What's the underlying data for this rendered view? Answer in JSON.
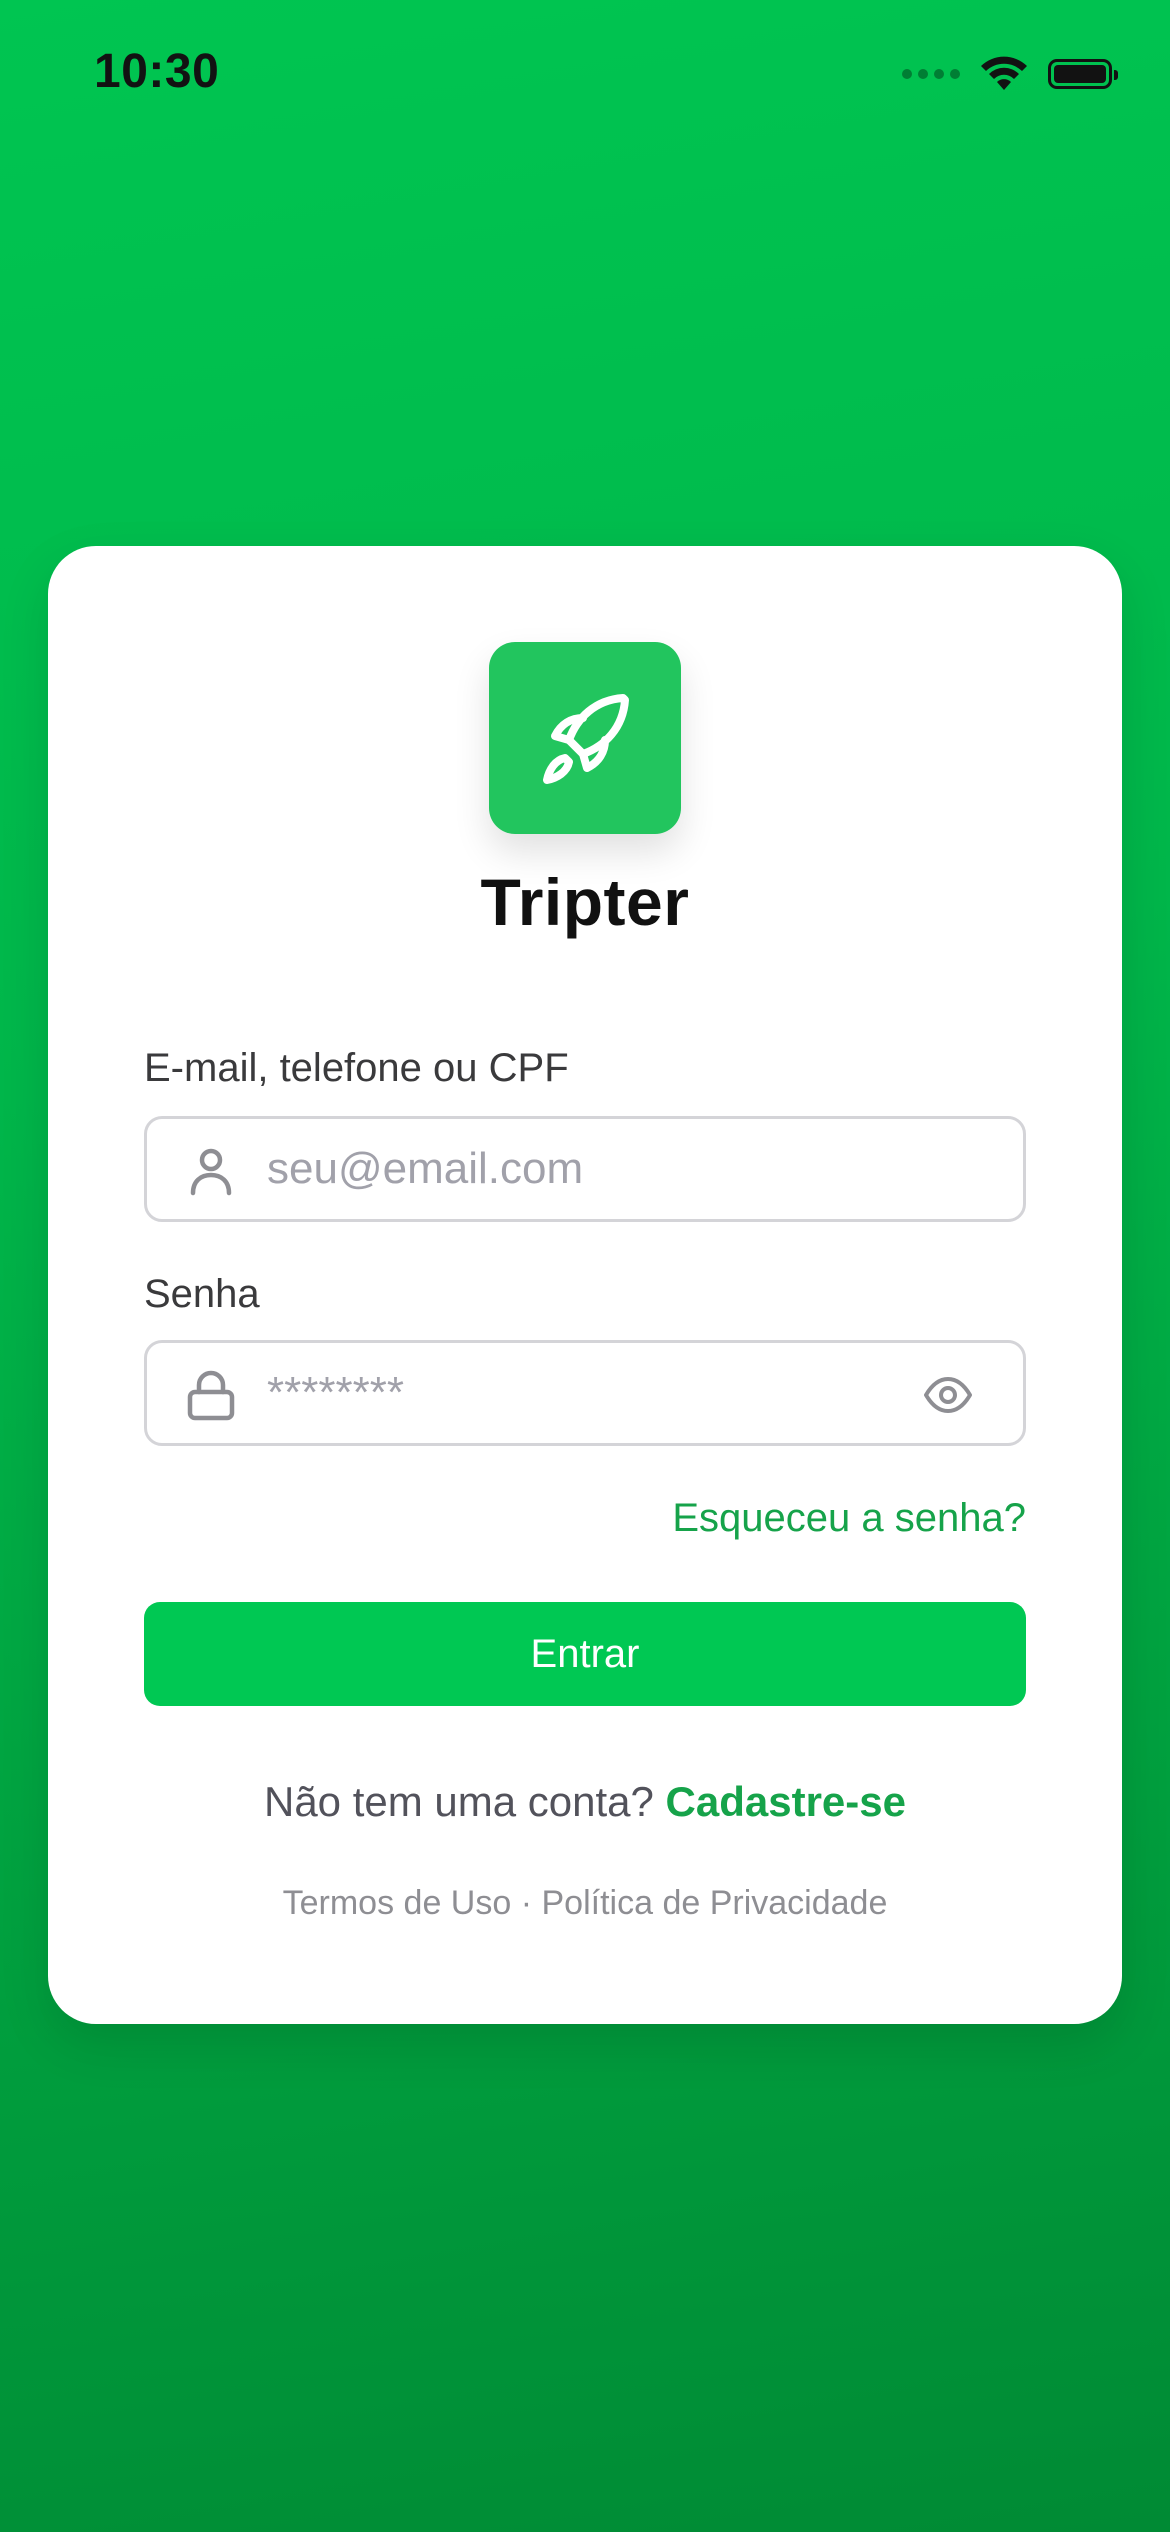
{
  "status_bar": {
    "time": "10:30"
  },
  "app": {
    "name": "Tripter",
    "logo_icon": "rocket-icon",
    "brand_color": "#22c55e"
  },
  "form": {
    "identifier": {
      "label": "E-mail, telefone ou CPF",
      "placeholder": "seu@email.com",
      "value": "",
      "icon": "user-icon"
    },
    "password": {
      "label": "Senha",
      "placeholder": "********",
      "value": "",
      "icon": "lock-icon",
      "toggle_icon": "eye-icon"
    },
    "forgot_label": "Esqueceu a senha?",
    "submit_label": "Entrar"
  },
  "footer": {
    "no_account_text": "Não tem uma conta?",
    "signup_label": "Cadastre-se",
    "terms_label": "Termos de Uso",
    "separator": "·",
    "privacy_label": "Política de Privacidade"
  },
  "colors": {
    "accent": "#16a34a",
    "button": "#00c853",
    "background_top": "#00c551",
    "background_bottom": "#008a34"
  }
}
